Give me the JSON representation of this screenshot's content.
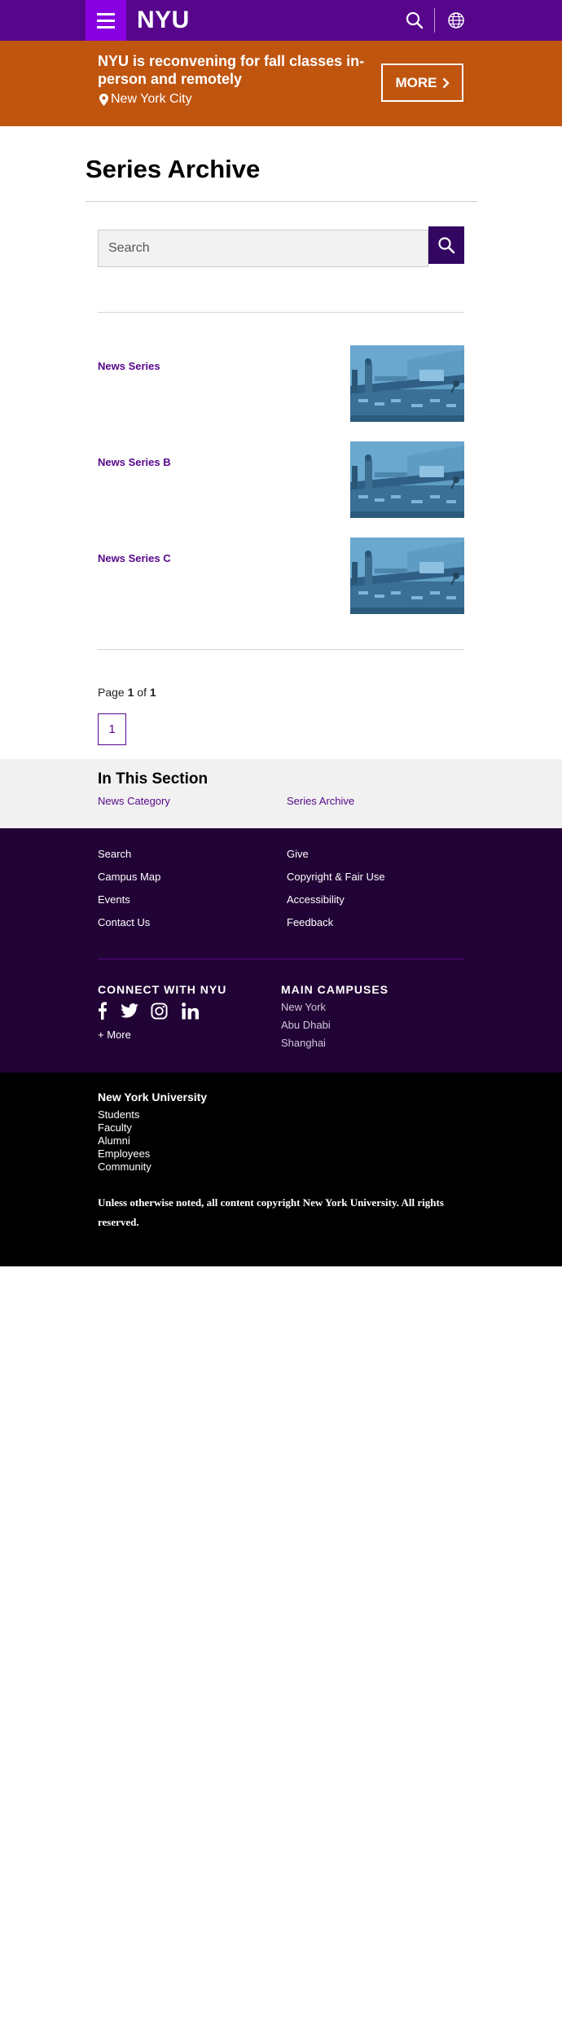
{
  "header": {
    "logo": "NYU"
  },
  "alert": {
    "title": "NYU is reconvening for fall classes in-person and remotely",
    "location": "New York City",
    "more_label": "MORE"
  },
  "page_title": "Series Archive",
  "search": {
    "placeholder": "Search"
  },
  "series": [
    {
      "title": "News Series"
    },
    {
      "title": "News Series B"
    },
    {
      "title": "News Series C"
    }
  ],
  "pagination": {
    "prefix": "Page",
    "current": "1",
    "of": "of",
    "total": "1",
    "button": "1"
  },
  "section_nav": {
    "title": "In This Section",
    "links": [
      "News Category",
      "Series Archive"
    ]
  },
  "footer": {
    "links_left": [
      "Search",
      "Campus Map",
      "Events",
      "Contact Us"
    ],
    "links_right": [
      "Give",
      "Copyright & Fair Use",
      "Accessibility",
      "Feedback"
    ],
    "connect_heading": "CONNECT WITH NYU",
    "more_label": "+ More",
    "campuses_heading": "MAIN CAMPUSES",
    "campuses": [
      "New York",
      "Abu Dhabi",
      "Shanghai"
    ],
    "social_icons": [
      "facebook-icon",
      "twitter-icon",
      "instagram-icon",
      "linkedin-icon"
    ]
  },
  "bottom": {
    "name": "New York University",
    "audiences": [
      "Students",
      "Faculty",
      "Alumni",
      "Employees",
      "Community"
    ],
    "copyright": "Unless otherwise noted, all content copyright New York University. All rights reserved."
  },
  "colors": {
    "primary_purple": "#57068c",
    "menu_purple": "#8900e1",
    "alert_orange": "#c05510",
    "footer_purple": "#220336",
    "search_button": "#330662"
  }
}
